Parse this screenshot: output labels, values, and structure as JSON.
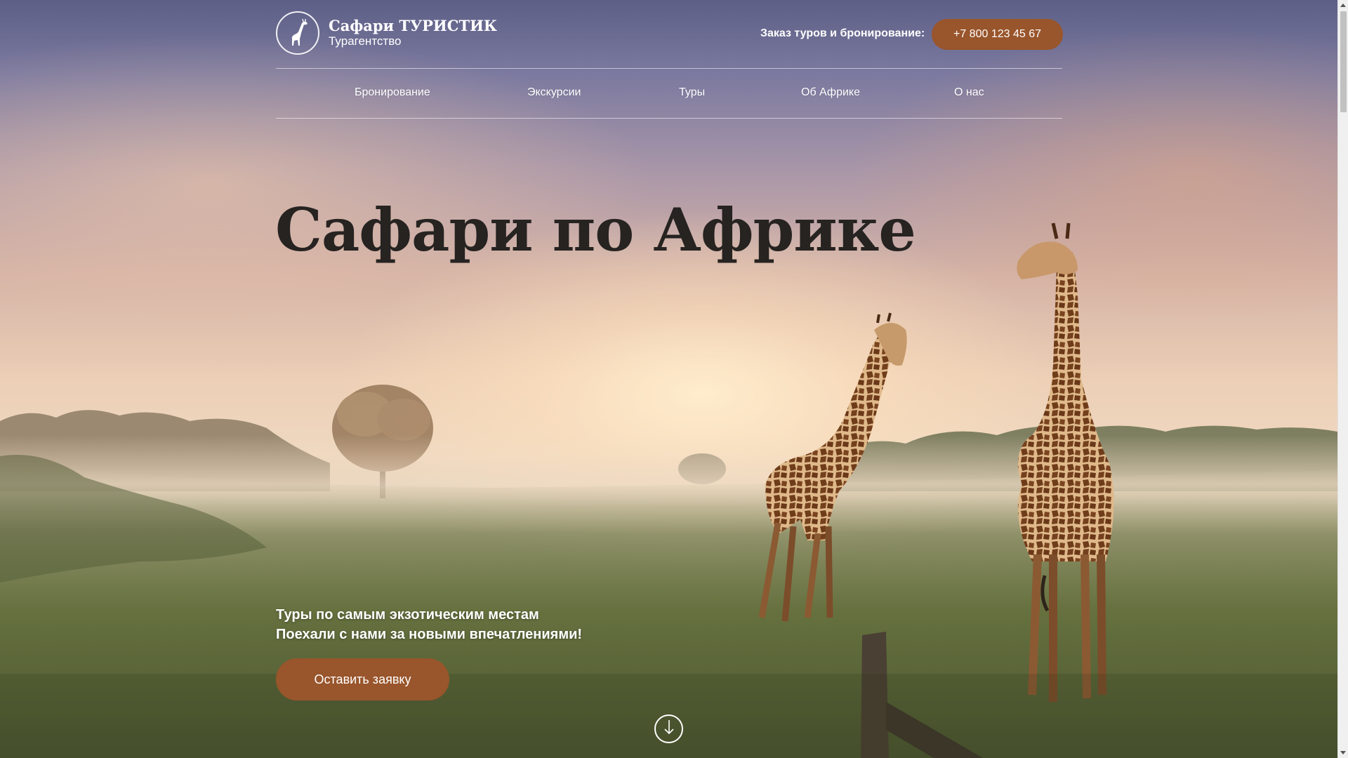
{
  "header": {
    "logo_title": "Сафари ТУРИСТИК",
    "logo_subtitle": "Турагентство",
    "contact_label": "Заказ туров и бронирование:",
    "phone": "+7 800 123 45 67"
  },
  "nav": {
    "items": [
      {
        "label": "Бронирование"
      },
      {
        "label": "Экскурсии"
      },
      {
        "label": "Туры"
      },
      {
        "label": "Об Африке"
      },
      {
        "label": "О нас"
      }
    ]
  },
  "hero": {
    "title": "Сафари по Африке",
    "tagline_line1": "Туры по самым экзотическим местам",
    "tagline_line2": "Поехали с нами за новыми впечатлениями!",
    "cta_label": "Оставить заявку"
  },
  "icons": {
    "logo": "giraffe-icon",
    "scroll": "arrow-down-icon"
  },
  "colors": {
    "accent": "#99552b",
    "title": "#262321"
  }
}
